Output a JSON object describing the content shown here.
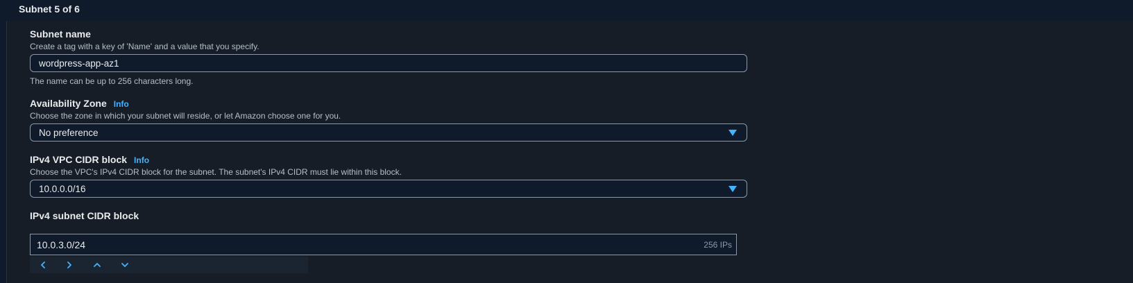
{
  "section": {
    "title": "Subnet 5 of 6"
  },
  "subnet_name": {
    "label": "Subnet name",
    "description": "Create a tag with a key of 'Name' and a value that you specify.",
    "value": "wordpress-app-az1",
    "constraint": "The name can be up to 256 characters long."
  },
  "availability_zone": {
    "label": "Availability Zone",
    "info": "Info",
    "description": "Choose the zone in which your subnet will reside, or let Amazon choose one for you.",
    "selected": "No preference"
  },
  "vpc_cidr": {
    "label": "IPv4 VPC CIDR block",
    "info": "Info",
    "description": "Choose the VPC's IPv4 CIDR block for the subnet. The subnet's IPv4 CIDR must lie within this block.",
    "selected": "10.0.0.0/16"
  },
  "subnet_cidr": {
    "label": "IPv4 subnet CIDR block",
    "value": "10.0.3.0/24",
    "ip_count": "256 IPs",
    "stepper_icons": [
      "chevron-left-icon",
      "chevron-right-icon",
      "chevron-up-icon",
      "chevron-down-icon"
    ]
  },
  "colors": {
    "background": "#0f1b2a",
    "panel": "#161d26",
    "accent": "#42b4ff",
    "text": "#e9ebed",
    "muted": "#b6bec9"
  }
}
